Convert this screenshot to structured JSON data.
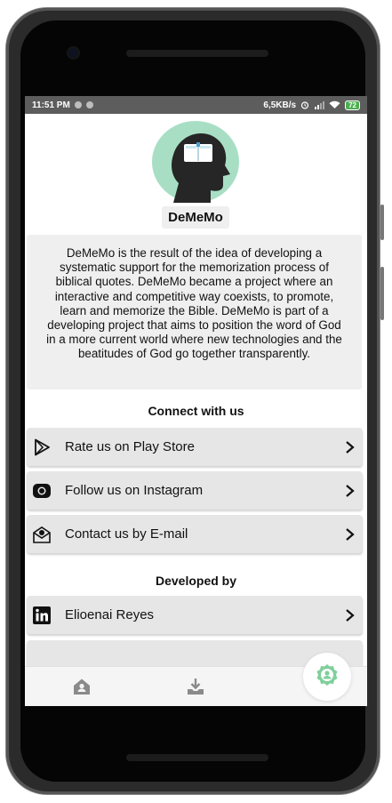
{
  "status_bar": {
    "time": "11:51 PM",
    "network_speed": "6,5KB/s",
    "battery": "72"
  },
  "app": {
    "name": "DeMeMo",
    "description": "DeMeMo is the result of the idea of developing a systematic support for the memorization process of biblical quotes. DeMeMo became a project where an interactive and competitive way coexists, to promote, learn and memorize the Bible. DeMeMo is part of a developing project that aims to position the word of God in a more current world where new technologies and the beatitudes of God go together transparently."
  },
  "connect": {
    "title": "Connect with us",
    "items": [
      {
        "label": "Rate us on Play Store",
        "icon": "play-store-icon"
      },
      {
        "label": "Follow us on Instagram",
        "icon": "instagram-icon"
      },
      {
        "label": "Contact us by E-mail",
        "icon": "email-icon"
      }
    ]
  },
  "developed": {
    "title": "Developed by",
    "items": [
      {
        "label": "Elioenai Reyes",
        "icon": "linkedin-icon"
      }
    ]
  },
  "tabbar": {
    "icons": [
      "home-icon",
      "download-icon",
      "about-icon"
    ]
  },
  "colors": {
    "logo_bg": "#a8dfc4",
    "accent": "#4caf50",
    "row_bg": "#e6e6e6"
  }
}
